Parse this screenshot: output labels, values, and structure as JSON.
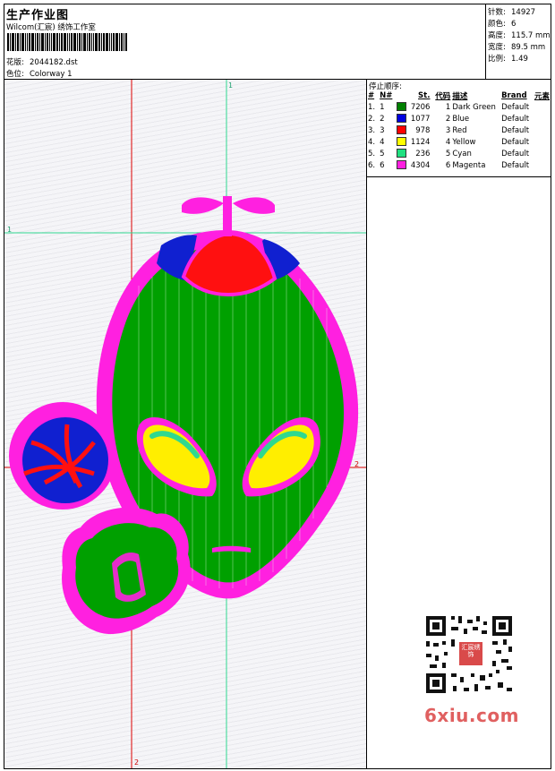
{
  "header": {
    "title": "生产作业图",
    "company": "Wilcom(汇宸) 绣饰工作室",
    "design_label": "花版:",
    "design_value": "2044182.dst",
    "colorway_label": "色位:",
    "colorway_value": "Colorway 1"
  },
  "stats": {
    "stitches_label": "针数:",
    "stitches_value": "14927",
    "colors_label": "颜色:",
    "colors_value": "6",
    "height_label": "高度:",
    "height_value": "115.7 mm",
    "width_label": "宽度:",
    "width_value": "89.5 mm",
    "scale_label": "比例:",
    "scale_value": "1.49"
  },
  "sequence": {
    "title": "停止顺序:",
    "columns": [
      "#",
      "N#",
      "St.",
      "代码",
      "描述",
      "Brand",
      "元素"
    ],
    "rows": [
      {
        "idx": "1.",
        "n": "1",
        "color": "#008000",
        "st": "7206",
        "code": "1",
        "desc": "Dark Green",
        "brand": "Default"
      },
      {
        "idx": "2.",
        "n": "2",
        "color": "#0000e0",
        "st": "1077",
        "code": "2",
        "desc": "Blue",
        "brand": "Default"
      },
      {
        "idx": "3.",
        "n": "3",
        "color": "#ff0000",
        "st": "978",
        "code": "3",
        "desc": "Red",
        "brand": "Default"
      },
      {
        "idx": "4.",
        "n": "4",
        "color": "#ffff00",
        "st": "1124",
        "code": "4",
        "desc": "Yellow",
        "brand": "Default"
      },
      {
        "idx": "5.",
        "n": "5",
        "color": "#20e080",
        "st": "236",
        "code": "5",
        "desc": "Cyan",
        "brand": "Default"
      },
      {
        "idx": "6.",
        "n": "6",
        "color": "#ff20e0",
        "st": "4304",
        "code": "6",
        "desc": "Magenta",
        "brand": "Default"
      }
    ]
  },
  "guides": {
    "top": "1",
    "left": "1",
    "right": "2",
    "bottom": "2"
  },
  "watermark": {
    "site": "6xiu.com",
    "seal": "汇宸绣饰"
  }
}
